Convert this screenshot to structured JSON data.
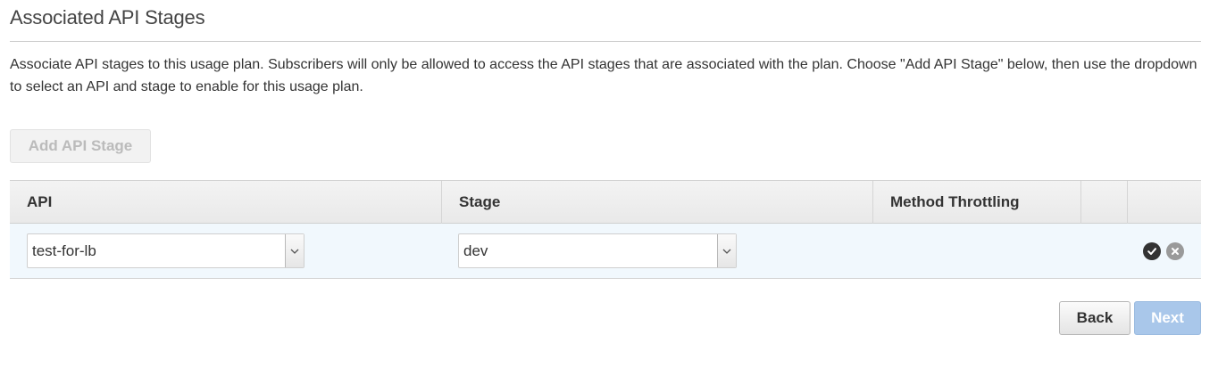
{
  "section": {
    "title": "Associated API Stages",
    "description": "Associate API stages to this usage plan. Subscribers will only be allowed to access the API stages that are associated with the plan. Choose \"Add API Stage\" below, then use the dropdown to select an API and stage to enable for this usage plan."
  },
  "add_button": {
    "label": "Add API Stage",
    "state": "disabled"
  },
  "table": {
    "columns": [
      "API",
      "Stage",
      "Method Throttling",
      "",
      ""
    ],
    "row": {
      "api_value": "test-for-lb",
      "stage_value": "dev",
      "confirm_icon": "check-circle-icon",
      "remove_icon": "x-circle-icon"
    }
  },
  "footer": {
    "back_label": "Back",
    "next_label": "Next",
    "next_state": "disabled"
  },
  "colors": {
    "row_highlight": "#f1f8fd",
    "next_disabled": "#a9c7ea",
    "divider": "#cccccc"
  }
}
